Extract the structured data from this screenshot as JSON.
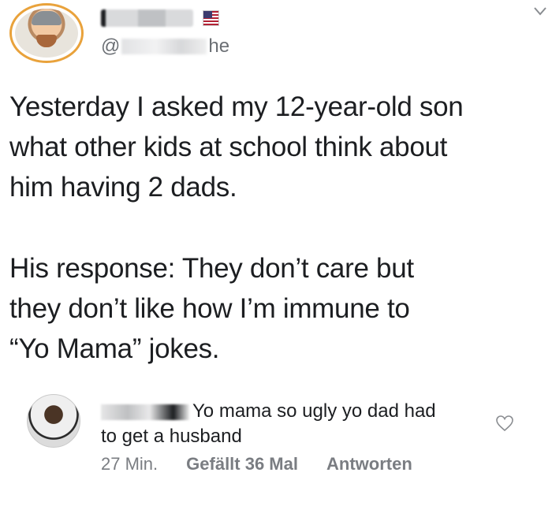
{
  "tweet": {
    "handle_prefix": "@",
    "handle_suffix": "he",
    "paragraphs": [
      "Yesterday I asked my 12-year-old son\nwhat other kids at school think about\nhim having 2 dads.",
      "His response: They don’t care but\nthey don’t like how I’m immune to\n“Yo Mama” jokes."
    ]
  },
  "comment": {
    "text_line1": "Yo mama so ugly yo dad had",
    "text_line2": "to get a husband",
    "time": "27 Min.",
    "likes": "Gefällt 36 Mal",
    "reply": "Antworten"
  },
  "icons": {
    "menu": "chevron-down-icon",
    "like": "heart-icon",
    "flag": "us-flag-icon"
  },
  "colors": {
    "text": "#1c1e21",
    "muted": "#7a7d82",
    "avatar_ring": "#e9a23b"
  }
}
